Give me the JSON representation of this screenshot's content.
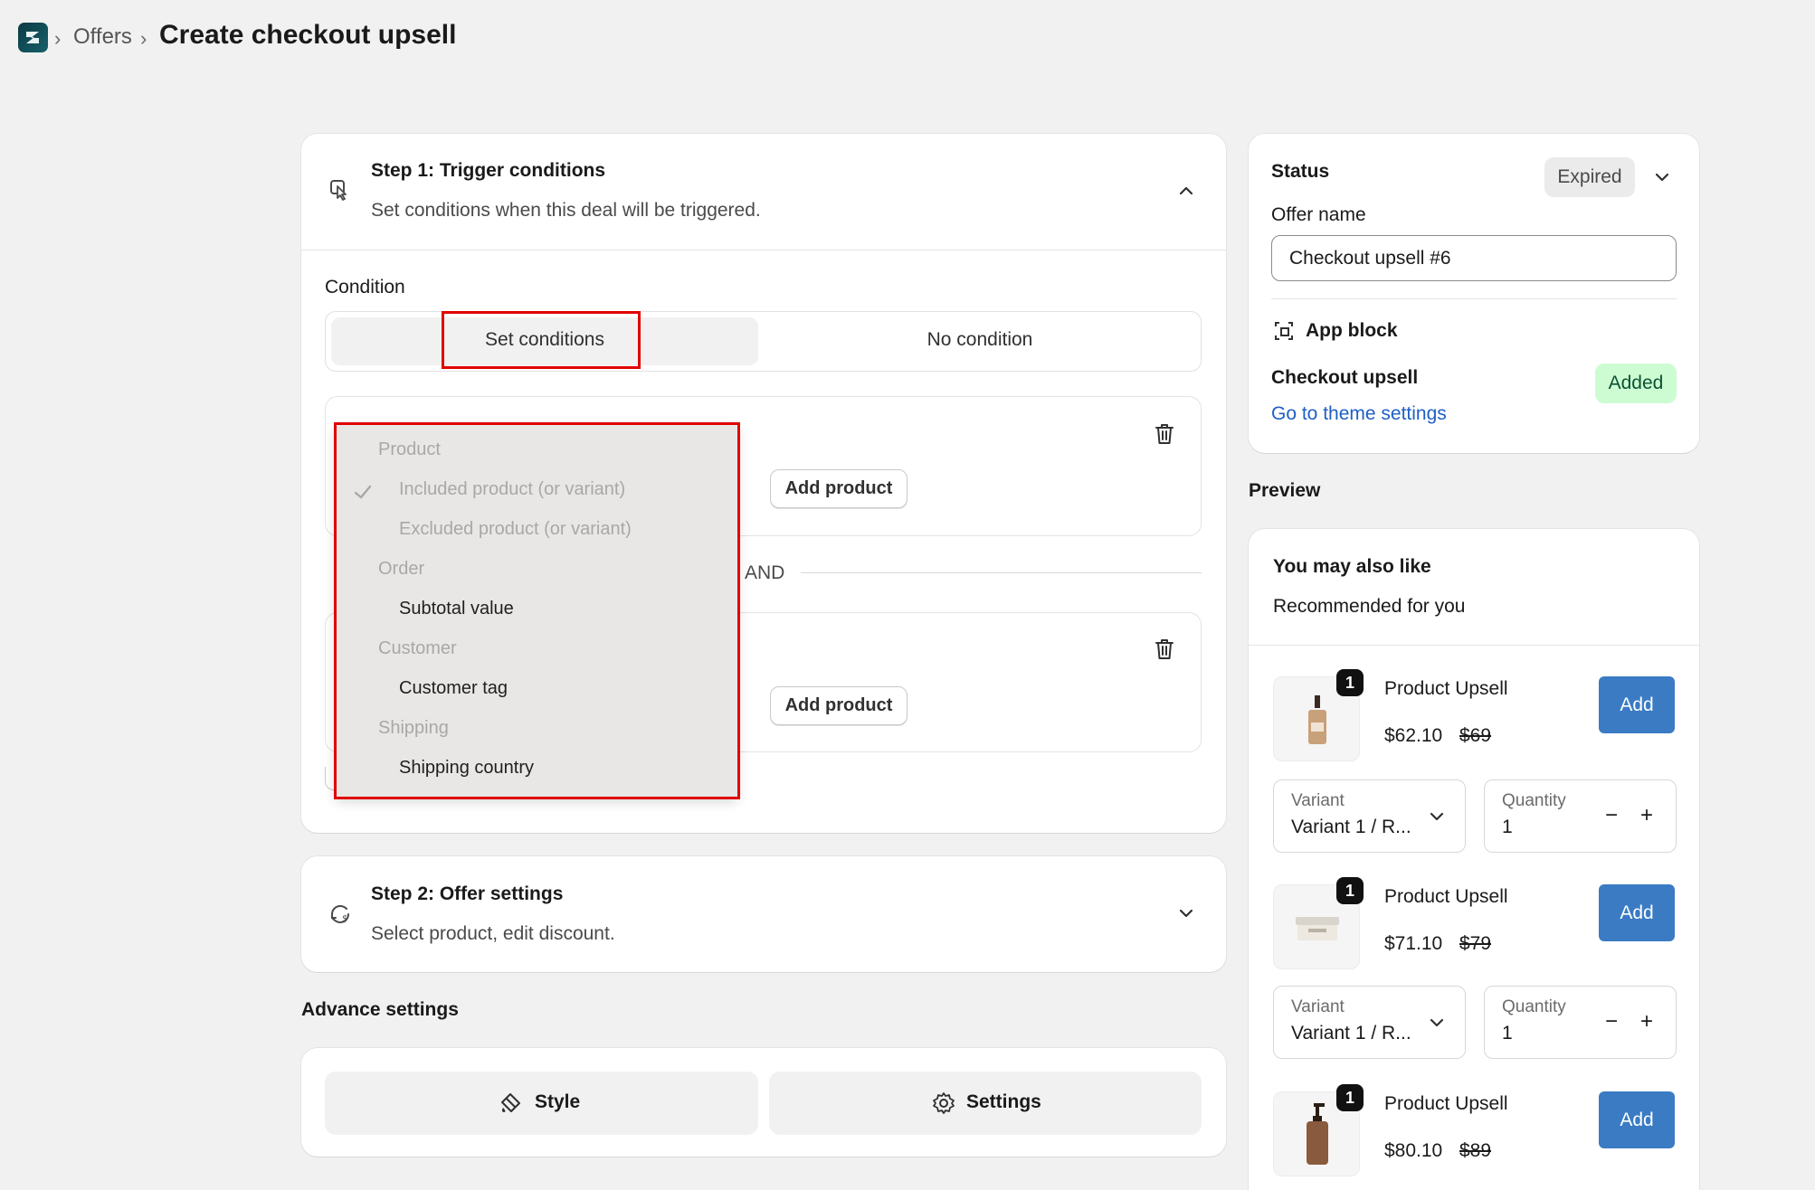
{
  "breadcrumb": {
    "separator": "›",
    "parent": "Offers",
    "title": "Create checkout upsell"
  },
  "step1": {
    "title": "Step 1: Trigger conditions",
    "subtitle": "Set conditions when this deal will be triggered.",
    "condition_label": "Condition",
    "segment": {
      "option_set": "Set conditions",
      "option_none": "No condition"
    },
    "and_label": "AND",
    "add_product_label": "Add product"
  },
  "dropdown": {
    "groups": [
      {
        "label": "Product",
        "items": [
          {
            "label": "Included product (or variant)",
            "checked": true,
            "disabled": true
          },
          {
            "label": "Excluded product (or variant)",
            "checked": false,
            "disabled": true
          }
        ]
      },
      {
        "label": "Order",
        "items": [
          {
            "label": "Subtotal value"
          }
        ]
      },
      {
        "label": "Customer",
        "items": [
          {
            "label": "Customer tag"
          }
        ]
      },
      {
        "label": "Shipping",
        "items": [
          {
            "label": "Shipping country"
          }
        ]
      }
    ]
  },
  "step2": {
    "title": "Step 2: Offer settings",
    "subtitle": "Select product, edit discount."
  },
  "advance": {
    "title": "Advance settings",
    "style_label": "Style",
    "settings_label": "Settings"
  },
  "status_card": {
    "status_label": "Status",
    "status_value": "Expired",
    "offer_name_label": "Offer name",
    "offer_name_value": "Checkout upsell #6",
    "app_block_label": "App block",
    "checkout_upsell_label": "Checkout upsell",
    "added_badge": "Added",
    "theme_link": "Go to theme settings"
  },
  "preview": {
    "title": "Preview",
    "heading": "You may also like",
    "subheading": "Recommended for you",
    "variant_label": "Variant",
    "quantity_label": "Quantity",
    "add_label": "Add",
    "minus": "−",
    "plus": "+",
    "products": [
      {
        "qty_badge": "1",
        "name": "Product Upsell",
        "price": "$62.10",
        "compare": "$69",
        "variant": "Variant 1 / R...",
        "quantity": "1"
      },
      {
        "qty_badge": "1",
        "name": "Product Upsell",
        "price": "$71.10",
        "compare": "$79",
        "variant": "Variant 1 / R...",
        "quantity": "1"
      },
      {
        "qty_badge": "1",
        "name": "Product Upsell",
        "price": "$80.10",
        "compare": "$89"
      }
    ]
  },
  "colors": {
    "accent": "#3a7bc4",
    "highlight": "#e10000",
    "link": "#1f5fc4",
    "added_bg": "#cdfcd3"
  }
}
